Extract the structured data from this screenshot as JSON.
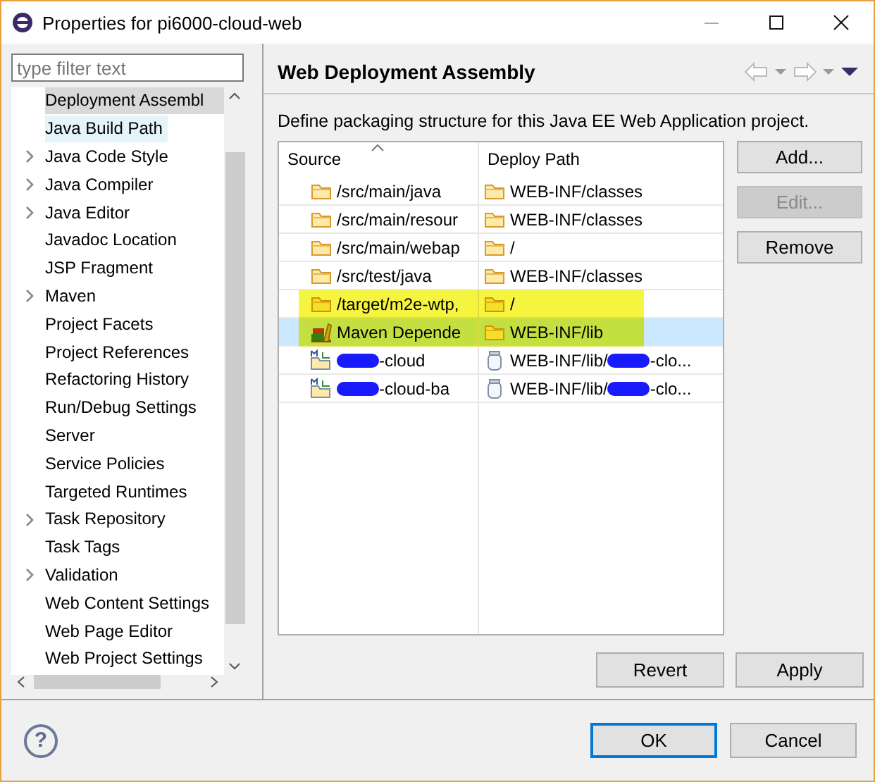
{
  "window": {
    "title": "Properties for pi6000-cloud-web"
  },
  "filter": {
    "placeholder": "type filter text"
  },
  "nav": [
    {
      "label": "Deployment Assembl",
      "expandable": false,
      "selected": true,
      "hovered": false
    },
    {
      "label": "Java Build Path",
      "expandable": false,
      "selected": false,
      "hovered": true
    },
    {
      "label": "Java Code Style",
      "expandable": true,
      "selected": false,
      "hovered": false
    },
    {
      "label": "Java Compiler",
      "expandable": true,
      "selected": false,
      "hovered": false
    },
    {
      "label": "Java Editor",
      "expandable": true,
      "selected": false,
      "hovered": false
    },
    {
      "label": "Javadoc Location",
      "expandable": false,
      "selected": false,
      "hovered": false
    },
    {
      "label": "JSP Fragment",
      "expandable": false,
      "selected": false,
      "hovered": false
    },
    {
      "label": "Maven",
      "expandable": true,
      "selected": false,
      "hovered": false
    },
    {
      "label": "Project Facets",
      "expandable": false,
      "selected": false,
      "hovered": false
    },
    {
      "label": "Project References",
      "expandable": false,
      "selected": false,
      "hovered": false
    },
    {
      "label": "Refactoring History",
      "expandable": false,
      "selected": false,
      "hovered": false
    },
    {
      "label": "Run/Debug Settings",
      "expandable": false,
      "selected": false,
      "hovered": false
    },
    {
      "label": "Server",
      "expandable": false,
      "selected": false,
      "hovered": false
    },
    {
      "label": "Service Policies",
      "expandable": false,
      "selected": false,
      "hovered": false
    },
    {
      "label": "Targeted Runtimes",
      "expandable": false,
      "selected": false,
      "hovered": false
    },
    {
      "label": "Task Repository",
      "expandable": true,
      "selected": false,
      "hovered": false
    },
    {
      "label": "Task Tags",
      "expandable": false,
      "selected": false,
      "hovered": false
    },
    {
      "label": "Validation",
      "expandable": true,
      "selected": false,
      "hovered": false
    },
    {
      "label": "Web Content Settings",
      "expandable": false,
      "selected": false,
      "hovered": false
    },
    {
      "label": "Web Page Editor",
      "expandable": false,
      "selected": false,
      "hovered": false
    },
    {
      "label": "Web Project Settings",
      "expandable": false,
      "selected": false,
      "hovered": false
    }
  ],
  "page": {
    "title": "Web Deployment Assembly",
    "description": "Define packaging structure for this Java EE Web Application project."
  },
  "table": {
    "columns": [
      "Source",
      "Deploy Path"
    ],
    "rows": [
      {
        "source": {
          "kind": "folder",
          "parts": [
            {
              "kind": "text",
              "text": "/src/main/java"
            }
          ]
        },
        "deploy": {
          "kind": "folder",
          "parts": [
            {
              "kind": "text",
              "text": "WEB-INF/classes"
            }
          ]
        },
        "selected": false,
        "highlighted": false
      },
      {
        "source": {
          "kind": "folder",
          "parts": [
            {
              "kind": "text",
              "text": "/src/main/resour"
            }
          ]
        },
        "deploy": {
          "kind": "folder",
          "parts": [
            {
              "kind": "text",
              "text": "WEB-INF/classes"
            }
          ]
        },
        "selected": false,
        "highlighted": false
      },
      {
        "source": {
          "kind": "folder",
          "parts": [
            {
              "kind": "text",
              "text": "/src/main/webap"
            }
          ]
        },
        "deploy": {
          "kind": "folder",
          "parts": [
            {
              "kind": "text",
              "text": "/"
            }
          ]
        },
        "selected": false,
        "highlighted": false
      },
      {
        "source": {
          "kind": "folder",
          "parts": [
            {
              "kind": "text",
              "text": "/src/test/java"
            }
          ]
        },
        "deploy": {
          "kind": "folder",
          "parts": [
            {
              "kind": "text",
              "text": "WEB-INF/classes"
            }
          ]
        },
        "selected": false,
        "highlighted": false
      },
      {
        "source": {
          "kind": "folder",
          "parts": [
            {
              "kind": "text",
              "text": "/target/m2e-wtp,"
            }
          ]
        },
        "deploy": {
          "kind": "folder",
          "parts": [
            {
              "kind": "text",
              "text": "/"
            }
          ]
        },
        "selected": false,
        "highlighted": true
      },
      {
        "source": {
          "kind": "library",
          "parts": [
            {
              "kind": "text",
              "text": "Maven Depende"
            }
          ]
        },
        "deploy": {
          "kind": "folder",
          "parts": [
            {
              "kind": "text",
              "text": "WEB-INF/lib"
            }
          ]
        },
        "selected": true,
        "highlighted": true
      },
      {
        "source": {
          "kind": "project",
          "parts": [
            {
              "kind": "scribble"
            },
            {
              "kind": "text",
              "text": "-cloud"
            }
          ]
        },
        "deploy": {
          "kind": "jar",
          "parts": [
            {
              "kind": "text",
              "text": "WEB-INF/lib/"
            },
            {
              "kind": "scribble"
            },
            {
              "kind": "text",
              "text": "-clo..."
            }
          ]
        },
        "selected": false,
        "highlighted": false
      },
      {
        "source": {
          "kind": "project",
          "parts": [
            {
              "kind": "scribble"
            },
            {
              "kind": "text",
              "text": "-cloud-ba"
            }
          ]
        },
        "deploy": {
          "kind": "jar",
          "parts": [
            {
              "kind": "text",
              "text": "WEB-INF/lib/"
            },
            {
              "kind": "scribble"
            },
            {
              "kind": "text",
              "text": "-clo..."
            }
          ]
        },
        "selected": false,
        "highlighted": false
      }
    ]
  },
  "side_buttons": [
    {
      "label": "Add...",
      "disabled": false
    },
    {
      "label": "Edit...",
      "disabled": true
    },
    {
      "label": "Remove",
      "disabled": false
    }
  ],
  "page_buttons": [
    {
      "label": "Revert",
      "disabled": false
    },
    {
      "label": "Apply",
      "disabled": false
    }
  ],
  "help": {
    "glyph": "?"
  },
  "dialog_buttons": [
    {
      "label": "OK",
      "default": true
    },
    {
      "label": "Cancel",
      "default": false
    }
  ]
}
